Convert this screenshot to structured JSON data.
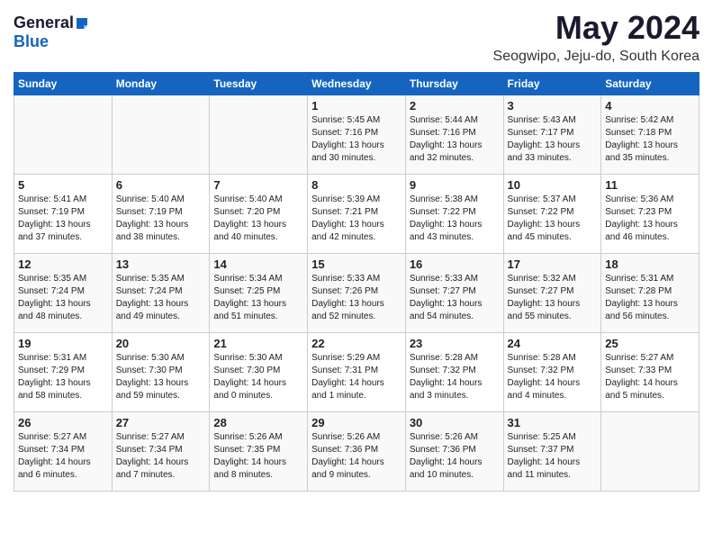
{
  "header": {
    "logo_general": "General",
    "logo_blue": "Blue",
    "month": "May 2024",
    "location": "Seogwipo, Jeju-do, South Korea"
  },
  "weekdays": [
    "Sunday",
    "Monday",
    "Tuesday",
    "Wednesday",
    "Thursday",
    "Friday",
    "Saturday"
  ],
  "weeks": [
    [
      {
        "day": "",
        "info": ""
      },
      {
        "day": "",
        "info": ""
      },
      {
        "day": "",
        "info": ""
      },
      {
        "day": "1",
        "info": "Sunrise: 5:45 AM\nSunset: 7:16 PM\nDaylight: 13 hours\nand 30 minutes."
      },
      {
        "day": "2",
        "info": "Sunrise: 5:44 AM\nSunset: 7:16 PM\nDaylight: 13 hours\nand 32 minutes."
      },
      {
        "day": "3",
        "info": "Sunrise: 5:43 AM\nSunset: 7:17 PM\nDaylight: 13 hours\nand 33 minutes."
      },
      {
        "day": "4",
        "info": "Sunrise: 5:42 AM\nSunset: 7:18 PM\nDaylight: 13 hours\nand 35 minutes."
      }
    ],
    [
      {
        "day": "5",
        "info": "Sunrise: 5:41 AM\nSunset: 7:19 PM\nDaylight: 13 hours\nand 37 minutes."
      },
      {
        "day": "6",
        "info": "Sunrise: 5:40 AM\nSunset: 7:19 PM\nDaylight: 13 hours\nand 38 minutes."
      },
      {
        "day": "7",
        "info": "Sunrise: 5:40 AM\nSunset: 7:20 PM\nDaylight: 13 hours\nand 40 minutes."
      },
      {
        "day": "8",
        "info": "Sunrise: 5:39 AM\nSunset: 7:21 PM\nDaylight: 13 hours\nand 42 minutes."
      },
      {
        "day": "9",
        "info": "Sunrise: 5:38 AM\nSunset: 7:22 PM\nDaylight: 13 hours\nand 43 minutes."
      },
      {
        "day": "10",
        "info": "Sunrise: 5:37 AM\nSunset: 7:22 PM\nDaylight: 13 hours\nand 45 minutes."
      },
      {
        "day": "11",
        "info": "Sunrise: 5:36 AM\nSunset: 7:23 PM\nDaylight: 13 hours\nand 46 minutes."
      }
    ],
    [
      {
        "day": "12",
        "info": "Sunrise: 5:35 AM\nSunset: 7:24 PM\nDaylight: 13 hours\nand 48 minutes."
      },
      {
        "day": "13",
        "info": "Sunrise: 5:35 AM\nSunset: 7:24 PM\nDaylight: 13 hours\nand 49 minutes."
      },
      {
        "day": "14",
        "info": "Sunrise: 5:34 AM\nSunset: 7:25 PM\nDaylight: 13 hours\nand 51 minutes."
      },
      {
        "day": "15",
        "info": "Sunrise: 5:33 AM\nSunset: 7:26 PM\nDaylight: 13 hours\nand 52 minutes."
      },
      {
        "day": "16",
        "info": "Sunrise: 5:33 AM\nSunset: 7:27 PM\nDaylight: 13 hours\nand 54 minutes."
      },
      {
        "day": "17",
        "info": "Sunrise: 5:32 AM\nSunset: 7:27 PM\nDaylight: 13 hours\nand 55 minutes."
      },
      {
        "day": "18",
        "info": "Sunrise: 5:31 AM\nSunset: 7:28 PM\nDaylight: 13 hours\nand 56 minutes."
      }
    ],
    [
      {
        "day": "19",
        "info": "Sunrise: 5:31 AM\nSunset: 7:29 PM\nDaylight: 13 hours\nand 58 minutes."
      },
      {
        "day": "20",
        "info": "Sunrise: 5:30 AM\nSunset: 7:30 PM\nDaylight: 13 hours\nand 59 minutes."
      },
      {
        "day": "21",
        "info": "Sunrise: 5:30 AM\nSunset: 7:30 PM\nDaylight: 14 hours\nand 0 minutes."
      },
      {
        "day": "22",
        "info": "Sunrise: 5:29 AM\nSunset: 7:31 PM\nDaylight: 14 hours\nand 1 minute."
      },
      {
        "day": "23",
        "info": "Sunrise: 5:28 AM\nSunset: 7:32 PM\nDaylight: 14 hours\nand 3 minutes."
      },
      {
        "day": "24",
        "info": "Sunrise: 5:28 AM\nSunset: 7:32 PM\nDaylight: 14 hours\nand 4 minutes."
      },
      {
        "day": "25",
        "info": "Sunrise: 5:27 AM\nSunset: 7:33 PM\nDaylight: 14 hours\nand 5 minutes."
      }
    ],
    [
      {
        "day": "26",
        "info": "Sunrise: 5:27 AM\nSunset: 7:34 PM\nDaylight: 14 hours\nand 6 minutes."
      },
      {
        "day": "27",
        "info": "Sunrise: 5:27 AM\nSunset: 7:34 PM\nDaylight: 14 hours\nand 7 minutes."
      },
      {
        "day": "28",
        "info": "Sunrise: 5:26 AM\nSunset: 7:35 PM\nDaylight: 14 hours\nand 8 minutes."
      },
      {
        "day": "29",
        "info": "Sunrise: 5:26 AM\nSunset: 7:36 PM\nDaylight: 14 hours\nand 9 minutes."
      },
      {
        "day": "30",
        "info": "Sunrise: 5:26 AM\nSunset: 7:36 PM\nDaylight: 14 hours\nand 10 minutes."
      },
      {
        "day": "31",
        "info": "Sunrise: 5:25 AM\nSunset: 7:37 PM\nDaylight: 14 hours\nand 11 minutes."
      },
      {
        "day": "",
        "info": ""
      }
    ]
  ]
}
